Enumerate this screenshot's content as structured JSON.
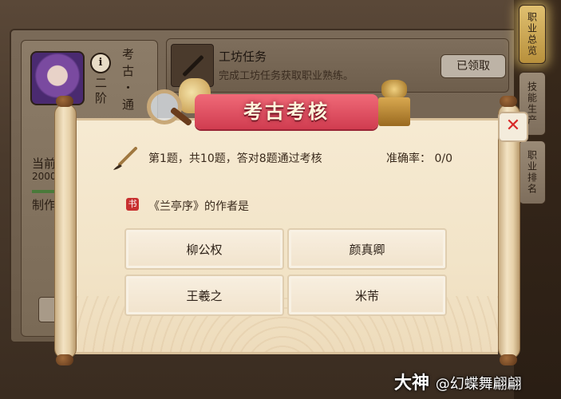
{
  "background": {
    "profile": {
      "name_chars": "考古・通",
      "rank": "二阶",
      "info_icon_glyph": "i",
      "current_label": "当前",
      "progress_value": "2000",
      "craft_label": "制作"
    },
    "task": {
      "title": "工坊任务",
      "description": "完成工坊任务获取职业熟练。",
      "claimed_label": "已领取"
    },
    "side_tabs": [
      {
        "label": "职业总览"
      },
      {
        "label": "技能生产"
      },
      {
        "label": "职业排名"
      }
    ]
  },
  "dialog": {
    "title": "考古考核",
    "close_glyph": "✕",
    "progress_text": "第1题，共10题，答对8题通过考核",
    "accuracy_text": "准确率：  0/0",
    "question_icon_glyph": "书",
    "question": "《兰亭序》的作者是",
    "options": [
      {
        "label": "柳公权"
      },
      {
        "label": "颜真卿"
      },
      {
        "label": "王羲之"
      },
      {
        "label": "米芾"
      }
    ]
  },
  "watermark": {
    "brand": "大神",
    "handle": "@幻蝶舞翩翩"
  },
  "colors": {
    "banner": "#d03c50",
    "close": "#d82828",
    "parchment": "#f2e4c8"
  }
}
